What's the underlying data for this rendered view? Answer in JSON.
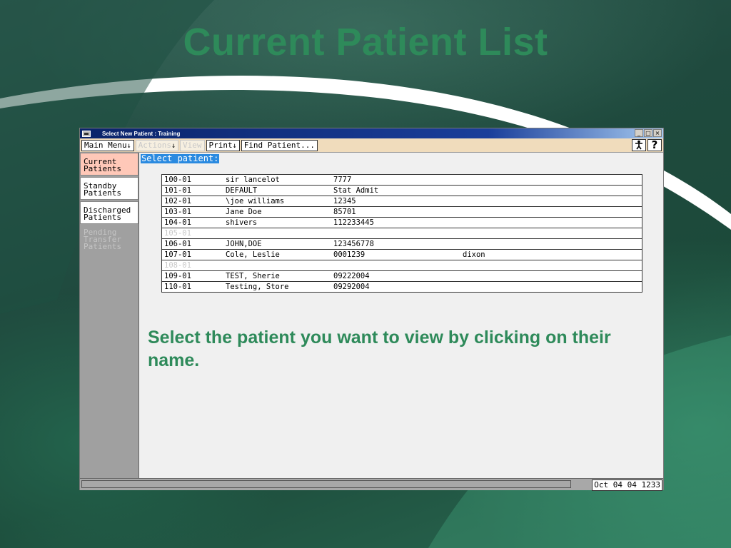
{
  "slide": {
    "title": "Current Patient List",
    "instruction": "Select the patient you want to view by clicking on their name."
  },
  "window": {
    "title": "Select New Patient :  Training",
    "controls": [
      "_",
      "□",
      "×"
    ]
  },
  "menubar": {
    "main_menu": "Main Menu",
    "actions": "Actions",
    "view": "View",
    "print": "Print",
    "find_patient": "Find Patient...",
    "arrow": "↓",
    "person_icon": "person-icon",
    "help_icon": "?"
  },
  "sidebar": {
    "items": [
      {
        "label": "Current\nPatients",
        "state": "active"
      },
      {
        "label": "Standby\nPatients",
        "state": "normal"
      },
      {
        "label": "Discharged\nPatients",
        "state": "normal"
      },
      {
        "label": "Pending\nTransfer\nPatients",
        "state": "disabled"
      }
    ]
  },
  "content": {
    "select_label": "Select patient:"
  },
  "patients": [
    {
      "id": "100-01",
      "name": "sir lancelot",
      "number": "7777",
      "extra": ""
    },
    {
      "id": "101-01",
      "name": "DEFAULT",
      "number": "Stat Admit",
      "extra": ""
    },
    {
      "id": "102-01",
      "name": "\\joe williams",
      "number": "12345",
      "extra": ""
    },
    {
      "id": "103-01",
      "name": "Jane Doe",
      "number": "85701",
      "extra": ""
    },
    {
      "id": "104-01",
      "name": "shivers",
      "number": "112233445",
      "extra": ""
    },
    {
      "id": "105-01",
      "name": "",
      "number": "",
      "extra": ""
    },
    {
      "id": "106-01",
      "name": "JOHN,DOE",
      "number": "123456778",
      "extra": ""
    },
    {
      "id": "107-01",
      "name": "Cole, Leslie",
      "number": "0001239",
      "extra": "dixon"
    },
    {
      "id": "108-01",
      "name": "",
      "number": "",
      "extra": ""
    },
    {
      "id": "109-01",
      "name": "TEST, Sherie",
      "number": "09222004",
      "extra": ""
    },
    {
      "id": "110-01",
      "name": "Testing, Store",
      "number": "09292004",
      "extra": ""
    }
  ],
  "statusbar": {
    "datetime": "Oct 04 04 1233"
  },
  "colors": {
    "title_green": "#2e8a5a",
    "active_tab": "#ffc8b8",
    "menubar": "#f0dcbc",
    "select_highlight": "#2a8ae0"
  }
}
